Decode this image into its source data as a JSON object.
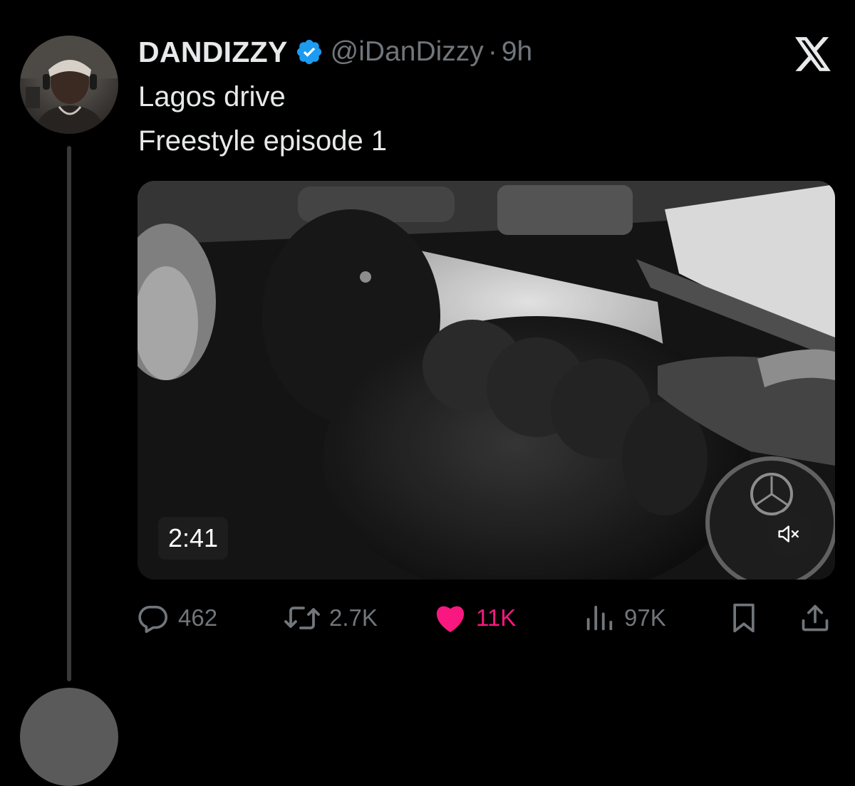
{
  "tweet": {
    "display_name": "DANDIZZY",
    "handle": "@iDanDizzy",
    "separator": "·",
    "time": "9h",
    "text_lines": [
      "Lagos drive",
      "Freestyle episode 1"
    ],
    "verified": true
  },
  "icons": {
    "verified": "verified-badge-icon",
    "brand": "x-logo-icon",
    "reply": "reply-bubble-icon",
    "retweet": "retweet-icon",
    "like": "heart-filled-icon",
    "views": "bar-chart-icon",
    "bookmark": "bookmark-icon",
    "share": "share-upload-icon",
    "mute": "speaker-muted-icon"
  },
  "media": {
    "duration": "2:41"
  },
  "actions": {
    "reply_count": "462",
    "retweet_count": "2.7K",
    "like_count": "11K",
    "views_count": "97K"
  },
  "colors": {
    "background": "#000000",
    "text": "#e7e9ea",
    "muted": "#71767b",
    "verified_blue": "#1d9bf0",
    "like_pink": "#f91880"
  }
}
